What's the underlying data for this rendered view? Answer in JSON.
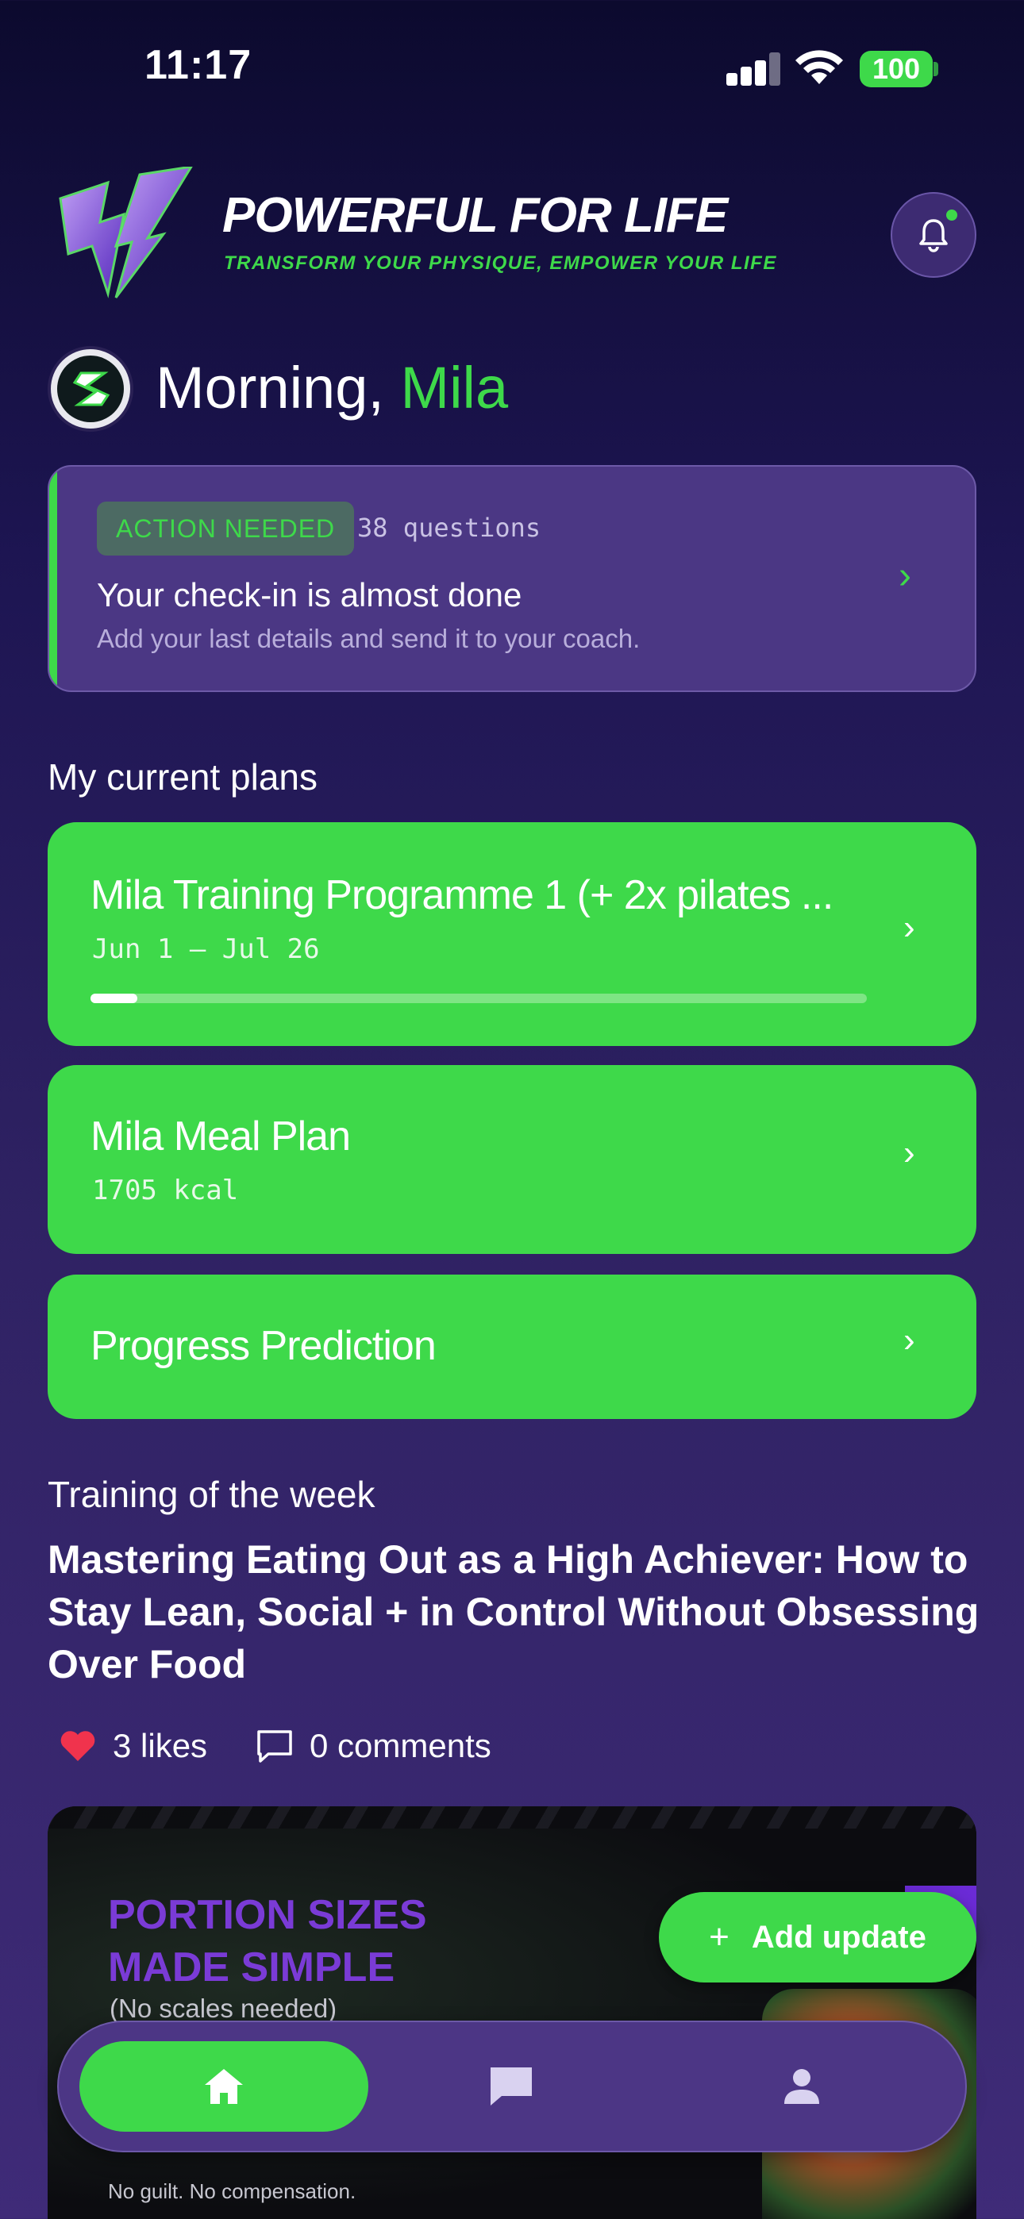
{
  "status_bar": {
    "time": "11:17",
    "battery": "100"
  },
  "header": {
    "brand_title": "POWERFUL FOR LIFE",
    "brand_tagline": "TRANSFORM YOUR PHYSIQUE, EMPOWER YOUR LIFE",
    "notification_icon": "bell-icon",
    "has_unread": true
  },
  "greeting": {
    "prefix": "Morning, ",
    "name": "Mila"
  },
  "action_card": {
    "badge": "ACTION NEEDED",
    "count": "38 questions",
    "title": "Your check-in is almost done",
    "subtitle": "Add your last details and send it to your coach."
  },
  "plans": {
    "section_label": "My current plans",
    "items": [
      {
        "title": "Mila Training Programme 1 (+ 2x pilates ...",
        "meta": "Jun 1 – Jul 26",
        "progress": 0.06
      },
      {
        "title": "Mila Meal Plan",
        "meta": "1705 kcal"
      },
      {
        "title": "Progress Prediction"
      }
    ]
  },
  "training": {
    "section_label": "Training of the week",
    "title": "Mastering Eating Out as a High Achiever: How to Stay Lean, Social + in Control Without Obsessing Over Food",
    "likes": "3 likes",
    "comments": "0 comments",
    "image": {
      "headline_line1": "PORTION SIZES",
      "headline_line2": "MADE SIMPLE",
      "subline": "(No scales needed)",
      "footer": "No guilt. No compensation."
    }
  },
  "fab": {
    "label": "Add update"
  },
  "bottom_nav": {
    "items": [
      "home",
      "chat",
      "profile"
    ],
    "active": "home"
  },
  "colors": {
    "accent_green": "#3ed94a",
    "card_purple": "#4b3784",
    "background_dark": "#0c0a2e"
  }
}
